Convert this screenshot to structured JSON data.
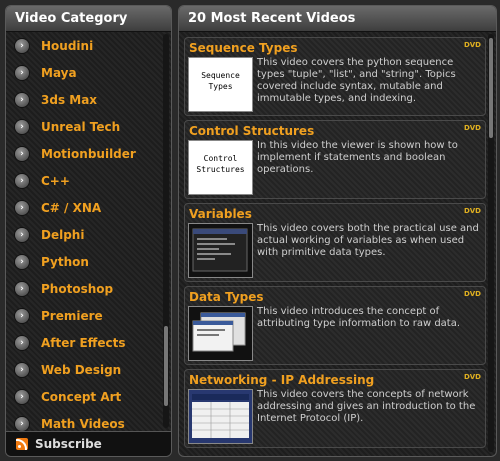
{
  "categories": {
    "header": "Video Category",
    "bullet_icon": "chevron-right",
    "items": [
      {
        "label": "Houdini"
      },
      {
        "label": "Maya"
      },
      {
        "label": "3ds Max"
      },
      {
        "label": "Unreal Tech"
      },
      {
        "label": "Motionbuilder"
      },
      {
        "label": "C++"
      },
      {
        "label": "C# / XNA"
      },
      {
        "label": "Delphi"
      },
      {
        "label": "Python"
      },
      {
        "label": "Photoshop"
      },
      {
        "label": "Premiere"
      },
      {
        "label": "After Effects"
      },
      {
        "label": "Web Design"
      },
      {
        "label": "Concept Art"
      },
      {
        "label": "Math Videos"
      }
    ],
    "subscribe": {
      "label": "Subscribe",
      "icon": "rss-icon"
    }
  },
  "videos": {
    "header": "20 Most Recent Videos",
    "badge_text": "DVD",
    "items": [
      {
        "title": "Sequence Types",
        "thumb_text": "Sequence Types",
        "description": "This video covers the python sequence types \"tuple\", \"list\", and \"string\". Topics covered include syntax, mutable and immutable types, and indexing."
      },
      {
        "title": "Control Structures",
        "thumb_text": "Control Structures",
        "description": "In this video the viewer is shown how to implement if statements and boolean operations."
      },
      {
        "title": "Variables",
        "thumb_text": "",
        "description": "This video covers both the practical use and actual working of variables as when used with primitive data types."
      },
      {
        "title": "Data Types",
        "thumb_text": "",
        "description": "This video introduces the concept of attributing type information to raw data."
      },
      {
        "title": "Networking - IP Addressing",
        "thumb_text": "",
        "description": "This video covers the concepts of network addressing and gives an introduction to the Internet Protocol (IP)."
      }
    ]
  },
  "colors": {
    "accent": "#f0a020",
    "text": "#cfcfcf",
    "header_text": "#ffffff",
    "rss": "#f07a10"
  }
}
